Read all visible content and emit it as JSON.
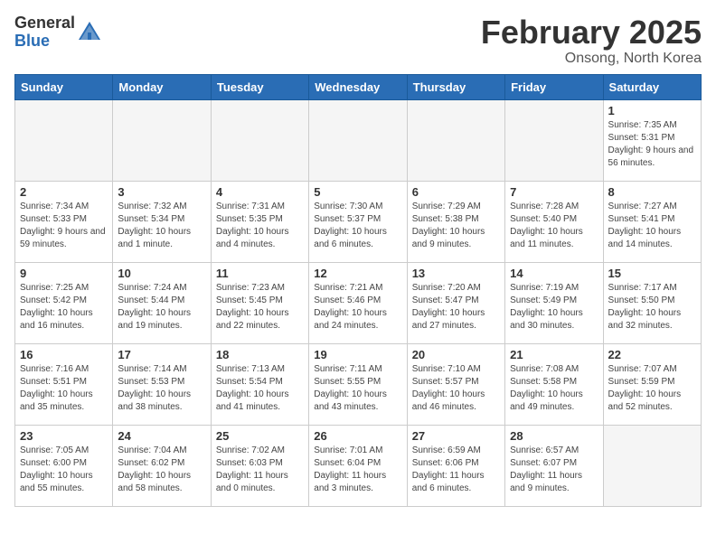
{
  "header": {
    "logo_general": "General",
    "logo_blue": "Blue",
    "month_title": "February 2025",
    "subtitle": "Onsong, North Korea"
  },
  "weekdays": [
    "Sunday",
    "Monday",
    "Tuesday",
    "Wednesday",
    "Thursday",
    "Friday",
    "Saturday"
  ],
  "weeks": [
    [
      {
        "num": "",
        "info": "",
        "empty": true
      },
      {
        "num": "",
        "info": "",
        "empty": true
      },
      {
        "num": "",
        "info": "",
        "empty": true
      },
      {
        "num": "",
        "info": "",
        "empty": true
      },
      {
        "num": "",
        "info": "",
        "empty": true
      },
      {
        "num": "",
        "info": "",
        "empty": true
      },
      {
        "num": "1",
        "info": "Sunrise: 7:35 AM\nSunset: 5:31 PM\nDaylight: 9 hours and 56 minutes."
      }
    ],
    [
      {
        "num": "2",
        "info": "Sunrise: 7:34 AM\nSunset: 5:33 PM\nDaylight: 9 hours and 59 minutes."
      },
      {
        "num": "3",
        "info": "Sunrise: 7:32 AM\nSunset: 5:34 PM\nDaylight: 10 hours and 1 minute."
      },
      {
        "num": "4",
        "info": "Sunrise: 7:31 AM\nSunset: 5:35 PM\nDaylight: 10 hours and 4 minutes."
      },
      {
        "num": "5",
        "info": "Sunrise: 7:30 AM\nSunset: 5:37 PM\nDaylight: 10 hours and 6 minutes."
      },
      {
        "num": "6",
        "info": "Sunrise: 7:29 AM\nSunset: 5:38 PM\nDaylight: 10 hours and 9 minutes."
      },
      {
        "num": "7",
        "info": "Sunrise: 7:28 AM\nSunset: 5:40 PM\nDaylight: 10 hours and 11 minutes."
      },
      {
        "num": "8",
        "info": "Sunrise: 7:27 AM\nSunset: 5:41 PM\nDaylight: 10 hours and 14 minutes."
      }
    ],
    [
      {
        "num": "9",
        "info": "Sunrise: 7:25 AM\nSunset: 5:42 PM\nDaylight: 10 hours and 16 minutes."
      },
      {
        "num": "10",
        "info": "Sunrise: 7:24 AM\nSunset: 5:44 PM\nDaylight: 10 hours and 19 minutes."
      },
      {
        "num": "11",
        "info": "Sunrise: 7:23 AM\nSunset: 5:45 PM\nDaylight: 10 hours and 22 minutes."
      },
      {
        "num": "12",
        "info": "Sunrise: 7:21 AM\nSunset: 5:46 PM\nDaylight: 10 hours and 24 minutes."
      },
      {
        "num": "13",
        "info": "Sunrise: 7:20 AM\nSunset: 5:47 PM\nDaylight: 10 hours and 27 minutes."
      },
      {
        "num": "14",
        "info": "Sunrise: 7:19 AM\nSunset: 5:49 PM\nDaylight: 10 hours and 30 minutes."
      },
      {
        "num": "15",
        "info": "Sunrise: 7:17 AM\nSunset: 5:50 PM\nDaylight: 10 hours and 32 minutes."
      }
    ],
    [
      {
        "num": "16",
        "info": "Sunrise: 7:16 AM\nSunset: 5:51 PM\nDaylight: 10 hours and 35 minutes."
      },
      {
        "num": "17",
        "info": "Sunrise: 7:14 AM\nSunset: 5:53 PM\nDaylight: 10 hours and 38 minutes."
      },
      {
        "num": "18",
        "info": "Sunrise: 7:13 AM\nSunset: 5:54 PM\nDaylight: 10 hours and 41 minutes."
      },
      {
        "num": "19",
        "info": "Sunrise: 7:11 AM\nSunset: 5:55 PM\nDaylight: 10 hours and 43 minutes."
      },
      {
        "num": "20",
        "info": "Sunrise: 7:10 AM\nSunset: 5:57 PM\nDaylight: 10 hours and 46 minutes."
      },
      {
        "num": "21",
        "info": "Sunrise: 7:08 AM\nSunset: 5:58 PM\nDaylight: 10 hours and 49 minutes."
      },
      {
        "num": "22",
        "info": "Sunrise: 7:07 AM\nSunset: 5:59 PM\nDaylight: 10 hours and 52 minutes."
      }
    ],
    [
      {
        "num": "23",
        "info": "Sunrise: 7:05 AM\nSunset: 6:00 PM\nDaylight: 10 hours and 55 minutes."
      },
      {
        "num": "24",
        "info": "Sunrise: 7:04 AM\nSunset: 6:02 PM\nDaylight: 10 hours and 58 minutes."
      },
      {
        "num": "25",
        "info": "Sunrise: 7:02 AM\nSunset: 6:03 PM\nDaylight: 11 hours and 0 minutes."
      },
      {
        "num": "26",
        "info": "Sunrise: 7:01 AM\nSunset: 6:04 PM\nDaylight: 11 hours and 3 minutes."
      },
      {
        "num": "27",
        "info": "Sunrise: 6:59 AM\nSunset: 6:06 PM\nDaylight: 11 hours and 6 minutes."
      },
      {
        "num": "28",
        "info": "Sunrise: 6:57 AM\nSunset: 6:07 PM\nDaylight: 11 hours and 9 minutes."
      },
      {
        "num": "",
        "info": "",
        "empty": true
      }
    ]
  ]
}
